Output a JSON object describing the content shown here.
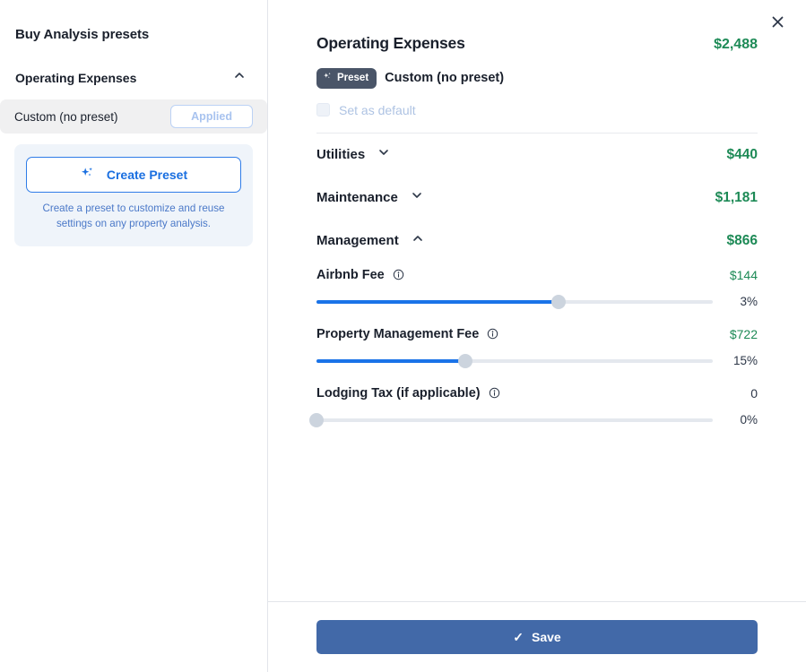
{
  "sidebar": {
    "title": "Buy Analysis presets",
    "section": {
      "label": "Operating Expenses",
      "chevron": "chevron-up-icon"
    },
    "preset_row": {
      "label": "Custom (no preset)",
      "action_label": "Applied"
    },
    "create_card": {
      "button_label": "Create Preset",
      "note": "Create a preset to customize and reuse settings on any property analysis."
    }
  },
  "panel": {
    "close_icon": "✕",
    "title": "Operating Expenses",
    "total": "$2,488",
    "preset_badge_label": "Preset",
    "preset_name": "Custom (no preset)",
    "set_as_default_label": "Set as default",
    "set_as_default_checked": false,
    "categories": [
      {
        "label": "Utilities",
        "amount": "$440",
        "chevron": "chevron-down-icon",
        "expanded": false
      },
      {
        "label": "Maintenance",
        "amount": "$1,181",
        "chevron": "chevron-down-icon",
        "expanded": false
      },
      {
        "label": "Management",
        "amount": "$866",
        "chevron": "chevron-up-icon",
        "expanded": true
      }
    ],
    "sliders": [
      {
        "label": "Airbnb Fee",
        "value": "$144",
        "percent_label": "3%",
        "fill_percent": 61,
        "is_zero": false,
        "info_icon": "info-icon"
      },
      {
        "label": "Property Management Fee",
        "value": "$722",
        "percent_label": "15%",
        "fill_percent": 37.5,
        "is_zero": false,
        "info_icon": "info-icon"
      },
      {
        "label": "Lodging Tax (if applicable)",
        "value": "0",
        "percent_label": "0%",
        "fill_percent": 0,
        "is_zero": true,
        "info_icon": "info-icon"
      }
    ]
  },
  "footer": {
    "save_label": "Save",
    "save_check_icon": "✓"
  },
  "colors": {
    "accent_green": "#1d8a56",
    "accent_blue": "#1a73e8",
    "save_blue": "#4269a8",
    "badge_slate": "#4a5568",
    "disabled_blue": "#aec3e3"
  }
}
